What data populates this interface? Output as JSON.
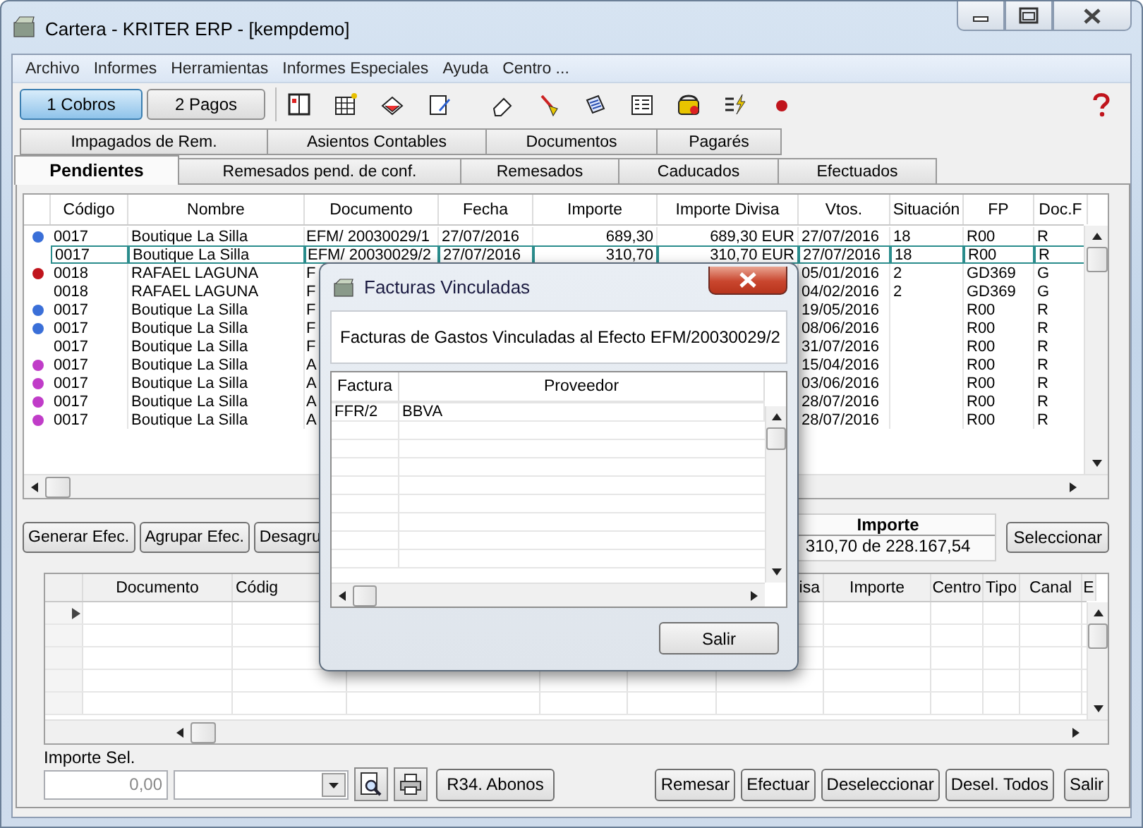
{
  "window": {
    "title": "Cartera - KRITER ERP - [kempdemo]"
  },
  "menu": [
    "Archivo",
    "Informes",
    "Herramientas",
    "Informes Especiales",
    "Ayuda",
    "Centro ..."
  ],
  "mode_buttons": [
    {
      "label": "1 Cobros",
      "selected": true
    },
    {
      "label": "2 Pagos",
      "selected": false
    }
  ],
  "tabs_top": [
    {
      "label": "Impagados de Rem.",
      "selected": false
    },
    {
      "label": "Asientos Contables",
      "selected": false
    },
    {
      "label": "Documentos",
      "selected": false
    },
    {
      "label": "Pagarés",
      "selected": false
    }
  ],
  "tabs": [
    {
      "label": "Pendientes",
      "selected": true
    },
    {
      "label": "Remesados pend. de conf.",
      "selected": false
    },
    {
      "label": "Remesados",
      "selected": false
    },
    {
      "label": "Caducados",
      "selected": false
    },
    {
      "label": "Efectuados",
      "selected": false
    }
  ],
  "table": {
    "columns": [
      "Código",
      "Nombre",
      "Documento",
      "Fecha",
      "Importe",
      "Importe Divisa",
      "Vtos.",
      "Situación",
      "FP",
      "Doc.F"
    ],
    "rows": [
      {
        "color": "#3a6fd8",
        "selected": false,
        "cells": [
          "0017",
          "Boutique La Silla",
          "EFM/ 20030029/1",
          "27/07/2016",
          "689,30",
          "689,30 EUR",
          "27/07/2016",
          "18",
          "R00",
          "R"
        ]
      },
      {
        "selected": true,
        "cells": [
          "0017",
          "Boutique La Silla",
          "EFM/ 20030029/2",
          "27/07/2016",
          "310,70",
          "310,70 EUR",
          "27/07/2016",
          "18",
          "R00",
          "R"
        ]
      },
      {
        "color": "#c0141c",
        "selected": false,
        "cells": [
          "0018",
          "RAFAEL LAGUNA",
          "F",
          null,
          null,
          null,
          "05/01/2016",
          "2",
          "GD369",
          "G"
        ]
      },
      {
        "selected": false,
        "cells": [
          "0018",
          "RAFAEL LAGUNA",
          "F",
          null,
          null,
          null,
          "04/02/2016",
          "2",
          "GD369",
          "G"
        ]
      },
      {
        "color": "#3a6fd8",
        "selected": false,
        "cells": [
          "0017",
          "Boutique La Silla",
          "F",
          null,
          null,
          null,
          "19/05/2016",
          null,
          "R00",
          "R"
        ]
      },
      {
        "color": "#3a6fd8",
        "selected": false,
        "cells": [
          "0017",
          "Boutique La Silla",
          "F",
          null,
          null,
          null,
          "08/06/2016",
          null,
          "R00",
          "R"
        ]
      },
      {
        "selected": false,
        "cells": [
          "0017",
          "Boutique La Silla",
          "F",
          null,
          null,
          null,
          "31/07/2016",
          null,
          "R00",
          "R"
        ]
      },
      {
        "color": "#c03cc8",
        "selected": false,
        "cells": [
          "0017",
          "Boutique La Silla",
          "A",
          null,
          null,
          null,
          "15/04/2016",
          null,
          "R00",
          "R"
        ]
      },
      {
        "color": "#c03cc8",
        "selected": false,
        "cells": [
          "0017",
          "Boutique La Silla",
          "A",
          null,
          null,
          null,
          "03/06/2016",
          null,
          "R00",
          "R"
        ]
      },
      {
        "color": "#c03cc8",
        "selected": false,
        "cells": [
          "0017",
          "Boutique La Silla",
          "A",
          null,
          null,
          null,
          "28/07/2016",
          null,
          "R00",
          "R"
        ]
      },
      {
        "color": "#c03cc8",
        "selected": false,
        "cells": [
          "0017",
          "Boutique La Silla",
          "A",
          null,
          null,
          null,
          "28/07/2016",
          null,
          "R00",
          "R"
        ]
      }
    ]
  },
  "actions": [
    "Generar Efec.",
    "Agrupar Efec.",
    "Desagru"
  ],
  "total": {
    "label": "Importe",
    "value": "310,70 de 228.167,54"
  },
  "select_button": "Seleccionar",
  "detail_table": {
    "columns": [
      "Documento",
      "Códig",
      "isa",
      "Importe",
      "Centro",
      "Tipo",
      "Canal",
      "E"
    ]
  },
  "importe_sel": {
    "label": "Importe Sel.",
    "value": "0,00"
  },
  "abonos_button": "R34. Abonos",
  "footer_buttons": [
    "Remesar",
    "Efectuar",
    "Deseleccionar",
    "Desel. Todos",
    "Salir"
  ],
  "dialog": {
    "title": "Facturas Vinculadas",
    "message": "Facturas de Gastos Vinculadas al Efecto EFM/20030029/2",
    "table": {
      "columns": [
        "Factura",
        "Proveedor"
      ],
      "rows": [
        {
          "factura": "FFR/2",
          "proveedor": "BBVA"
        }
      ]
    },
    "button": "Salir"
  }
}
